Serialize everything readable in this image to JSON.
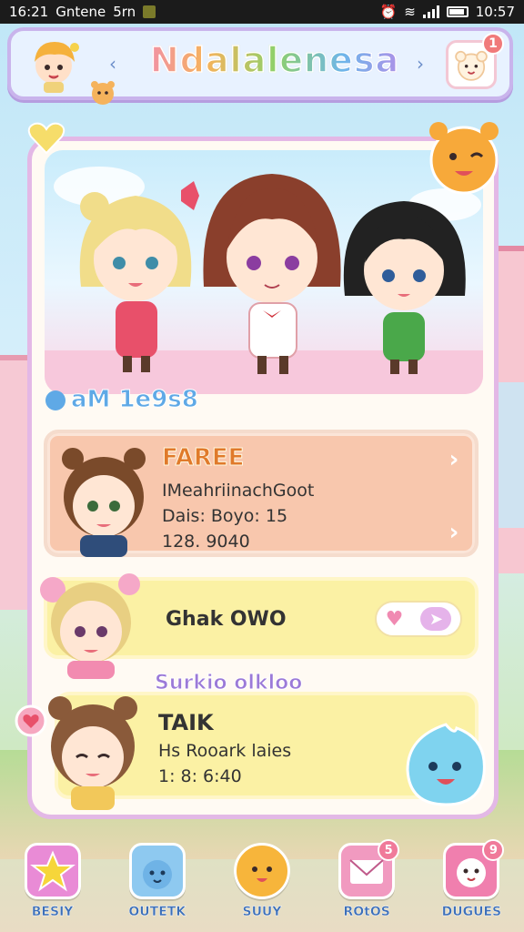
{
  "status_bar": {
    "time_left": "16:21",
    "carrier": "Gntene",
    "extra": "5rn",
    "time_right": "10:57"
  },
  "header": {
    "title": "Ndalalenesa",
    "prev_icon": "chevron-left-icon",
    "next_icon": "chevron-right-icon",
    "profile_badge": "1"
  },
  "section": {
    "title": "aM 1e9s8"
  },
  "cards": [
    {
      "title": "FAREE",
      "line1": "IMeahriinachGoot",
      "line2": "Dais: Boyo: 15",
      "line3": "128. 9040"
    },
    {
      "title": "Ghak OWO"
    },
    {
      "subheading": "Surkio olkloo",
      "title": "TAIK",
      "line1": "Hs Rooark laies",
      "line2": "1: 8: 6:40"
    }
  ],
  "bottom_nav": [
    {
      "label": "BESIY",
      "icon": "star-book-icon",
      "color": "#e98bd6",
      "badge": ""
    },
    {
      "label": "OUTETK",
      "icon": "cat-face-icon",
      "color": "#8ec9f0",
      "badge": ""
    },
    {
      "label": "SUUY",
      "icon": "chick-face-icon",
      "color": "#f7b53b",
      "badge": ""
    },
    {
      "label": "ROtOS",
      "icon": "letter-icon",
      "color": "#f19ac0",
      "badge": "5"
    },
    {
      "label": "DUGUES",
      "icon": "pink-bear-icon",
      "color": "#f07fae",
      "badge": "9"
    }
  ],
  "colors": {
    "panel_border": "#e3b8e6",
    "card1_bg": "#f8c7ad",
    "card_yellow_bg": "#fbf1a4",
    "accent_blue": "#5fa9e6",
    "title_orange": "#e07a2a"
  }
}
